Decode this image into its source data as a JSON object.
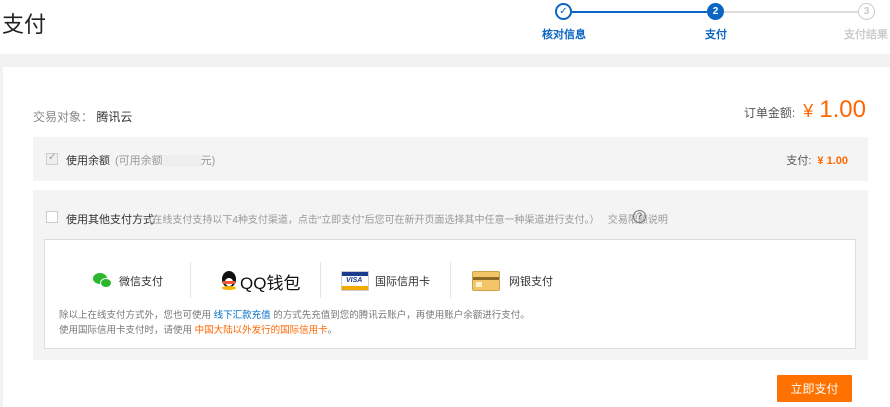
{
  "header": {
    "title": "支付"
  },
  "steps": [
    {
      "index": "✓",
      "label": "核对信息",
      "status": "done"
    },
    {
      "index": "2",
      "label": "支付",
      "status": "active"
    },
    {
      "index": "3",
      "label": "支付结果",
      "status": "pending"
    }
  ],
  "trade": {
    "target_label": "交易对象：",
    "target_value": "腾讯云"
  },
  "order": {
    "amount_label": "订单金额:",
    "currency": "¥",
    "amount": "1.00"
  },
  "balance": {
    "checked": true,
    "label": "使用余额",
    "available_prefix": "(可用余额",
    "available_suffix": "元)",
    "pay_label": "支付:",
    "pay_amount": "¥ 1.00"
  },
  "other_methods": {
    "checked": false,
    "label": "使用其他支付方式",
    "description": "(在线支付支持以下4种支付渠道，点击“立即支付”后您可在新开页面选择其中任意一种渠道进行支付。）",
    "limit_link": "交易限额说明",
    "info_icon": "?",
    "methods": [
      {
        "icon": "wechat-icon",
        "name": "微信支付"
      },
      {
        "icon": "qq-wallet-icon",
        "name": "QQ钱包"
      },
      {
        "icon": "visa-card-icon",
        "name": "国际信用卡"
      },
      {
        "icon": "bank-card-icon",
        "name": "网银支付"
      }
    ],
    "note1_prefix": "除以上在线支付方式外，您也可使用 ",
    "note1_link": "线下汇款充值",
    "note1_suffix": " 的方式先充值到您的腾讯云账户，再使用账户余额进行支付。",
    "note2_prefix": "使用国际信用卡支付时，请使用 ",
    "note2_warn": "中国大陆以外发行的国际信用卡",
    "note2_suffix": "。"
  },
  "actions": {
    "pay_now": "立即支付"
  },
  "colors": {
    "primary": "#0b66c3",
    "accent": "#ff7200",
    "price": "#ff6600",
    "link": "#0070cc"
  }
}
